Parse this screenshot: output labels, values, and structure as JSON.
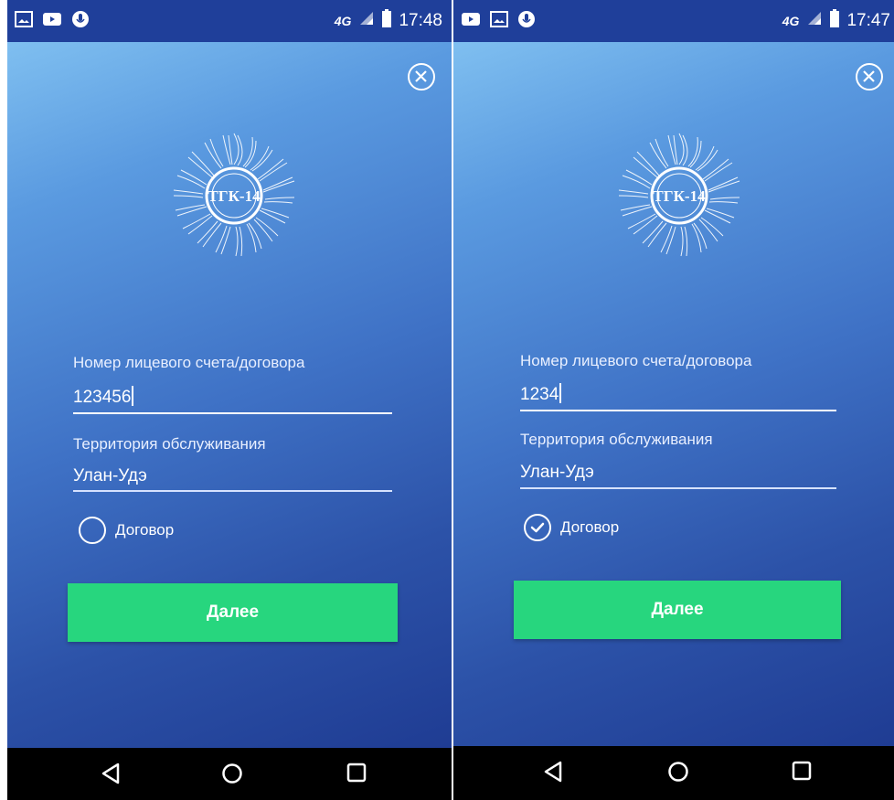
{
  "screens": {
    "left": {
      "status_time": "17:48",
      "network": "4G",
      "account_label": "Номер лицевого счета/договора",
      "account_value": "123456",
      "territory_label": "Территория обслуживания",
      "territory_value": "Улан-Удэ",
      "contract_label": "Договор",
      "contract_checked": false,
      "next_label": "Далее"
    },
    "right": {
      "status_time": "17:47",
      "network": "4G",
      "account_label": "Номер лицевого счета/договора",
      "account_value": "1234",
      "territory_label": "Территория обслуживания",
      "territory_value": "Улан-Удэ",
      "contract_label": "Договор",
      "contract_checked": true,
      "next_label": "Далее"
    }
  },
  "logo_text": "ТГК-14",
  "icons": {
    "status_left": [
      "gallery-icon",
      "youtube-icon",
      "microphone-icon"
    ],
    "status_right": [
      "lte-icon",
      "signal-icon",
      "battery-icon"
    ],
    "close": "close-circle-icon",
    "nav": [
      "back-icon",
      "home-icon",
      "recents-icon"
    ]
  },
  "colors": {
    "status_bar": "#1f3f9a",
    "gradient_top": "#7fbff0",
    "gradient_bottom": "#1f3c93",
    "button": "#27d67e",
    "nav_bar": "#000000"
  }
}
